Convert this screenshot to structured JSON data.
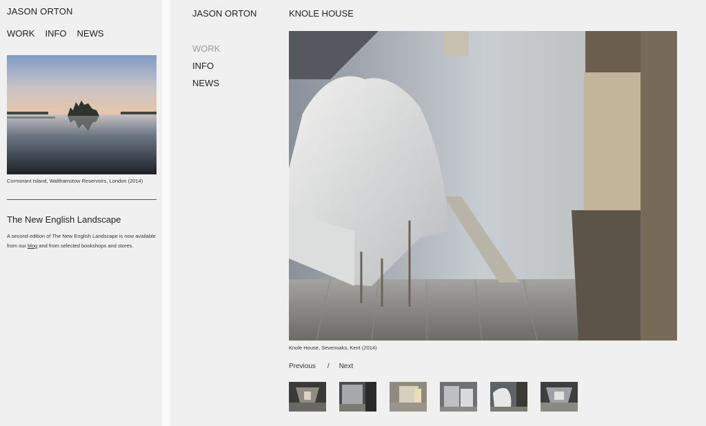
{
  "site": {
    "name": "JASON ORTON"
  },
  "sidebar": {
    "nav": [
      "WORK",
      "INFO",
      "NEWS"
    ],
    "photo_caption": "Cormorant Island, Walthamstow Reservoirs, London (2014)",
    "book_title": "The New English Landscape",
    "book_text_before": "A second edition of The New English Landscape is now available from our ",
    "book_link": "blog",
    "book_text_after": " and from selected bookshops and stores."
  },
  "main": {
    "site_name": "JASON ORTON",
    "page_title": "KNOLE HOUSE",
    "nav": {
      "work": "WORK",
      "info": "INFO",
      "news": "NEWS"
    },
    "photo_caption": "Knole House, Sevenoaks, Kent (2014)",
    "pager": {
      "previous": "Previous",
      "separator": "/",
      "next": "Next"
    }
  }
}
